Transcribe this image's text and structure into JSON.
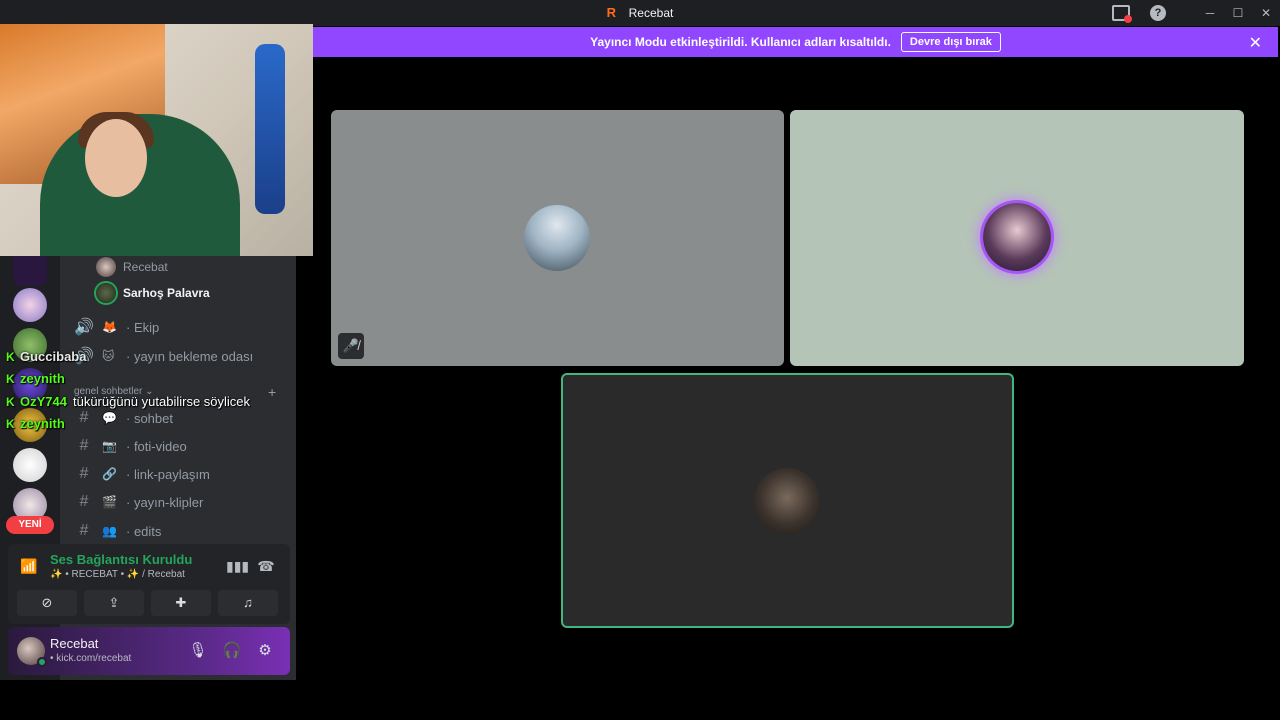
{
  "window": {
    "title": "Recebat",
    "logo_letter": "R"
  },
  "window_controls": {
    "minimize": "─",
    "maximize": "☐",
    "close": "✕",
    "help": "?"
  },
  "banner": {
    "message": "Yayıncı Modu etkinleştirildi. Kullanıcı adları kısaltıldı.",
    "button": "Devre dışı bırak",
    "close": "✕",
    "color": "#9146ff"
  },
  "server_rail": {
    "new_badge": "YENİ"
  },
  "voice_channel_users": [
    {
      "name": "Recebat"
    },
    {
      "name": "Sarhoş Palavra"
    }
  ],
  "channels": [
    {
      "icon": "speaker-icon",
      "emoji": "🦊",
      "label": "· Ekip"
    },
    {
      "icon": "speaker-icon",
      "emoji": "🐱",
      "label": "· yayın bekleme odası"
    }
  ],
  "category": {
    "label": "genel sohbetler ⌄",
    "add": "+"
  },
  "text_channels": [
    {
      "emoji": "💬",
      "label": "· sohbet"
    },
    {
      "emoji": "📷",
      "label": "· foti-video"
    },
    {
      "emoji": "🔗",
      "label": "· link-paylaşım"
    },
    {
      "emoji": "🎬",
      "label": "· yayın-klipler"
    },
    {
      "emoji": "👥",
      "label": "· edits"
    }
  ],
  "chat_overlay": [
    {
      "badge": "K",
      "user": "Guccibaba",
      "message": ""
    },
    {
      "badge": "K",
      "user": "zeynith",
      "message": ""
    },
    {
      "badge": "K",
      "user": "OzY744",
      "message": "tükürüğünü yutabilirse söylicek"
    },
    {
      "badge": "K",
      "user": "zeynith",
      "message": ""
    }
  ],
  "voice_panel": {
    "title": "Ses Bağlantısı Kuruldu",
    "subtitle": "✨ • RECEBAT • ✨ / Recebat",
    "buttons": [
      "camera-off",
      "screen-share",
      "activities",
      "soundboard"
    ]
  },
  "user_panel": {
    "name": "Recebat",
    "status": "• kick.com/recebat"
  },
  "video_tiles": [
    {
      "id": "tile-1",
      "bg": "#8a8d8e",
      "muted": true
    },
    {
      "id": "tile-2",
      "bg": "#b4c4b6",
      "speaking_ring": "#a855f7"
    },
    {
      "id": "tile-3",
      "bg": "#2a2a2a",
      "speaking_border": "#43b581"
    }
  ],
  "colors": {
    "accent_green": "#23a55a",
    "kick_green": "#53fc18",
    "banner_purple": "#9146ff",
    "new_badge_red": "#f23f43"
  }
}
